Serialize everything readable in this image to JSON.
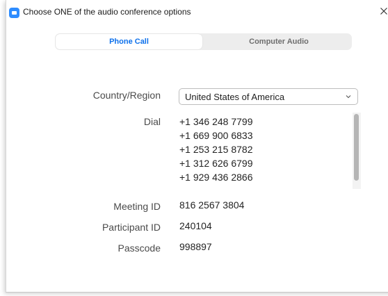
{
  "window": {
    "title": "Choose ONE of the audio conference options"
  },
  "tabs": [
    {
      "label": "Phone Call",
      "selected": true
    },
    {
      "label": "Computer Audio",
      "selected": false
    }
  ],
  "form": {
    "country_label": "Country/Region",
    "country_value": "United States of America",
    "dial_label": "Dial",
    "dial_numbers": [
      "+1 346 248 7799",
      "+1 669 900 6833",
      "+1 253 215 8782",
      "+1 312 626 6799",
      "+1 929 436 2866"
    ],
    "meeting_id_label": "Meeting ID",
    "meeting_id_value": "816 2567 3804",
    "participant_id_label": "Participant ID",
    "participant_id_value": "240104",
    "passcode_label": "Passcode",
    "passcode_value": "998897"
  },
  "icons": {
    "app": "zoom-app-icon",
    "close": "close-icon",
    "dropdown": "chevron-down-icon"
  },
  "colors": {
    "accent": "#0e71eb",
    "app_icon": "#2d8cff",
    "tab_bg": "#ededed",
    "scroll_thumb": "#b5b5b5"
  }
}
